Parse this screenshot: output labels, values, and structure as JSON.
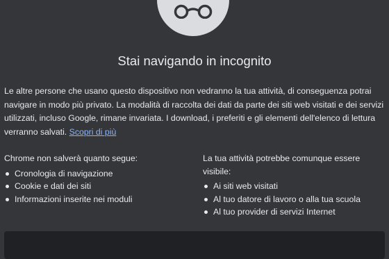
{
  "page": {
    "title": "Stai navigando in incognito",
    "intro_text": "Le altre persone che usano questo dispositivo non vedranno la tua attività, di conseguenza potrai navigare in modo più privato. La modalità di raccolta dei dati da parte dei siti web visitati e dei servizi utilizzati, incluso Google, rimane invariata. I download, i preferiti e gli elementi dell'elenco di lettura verranno salvati.",
    "learn_more_link": "Scopri di più"
  },
  "not_saved": {
    "heading": "Chrome non salverà quanto segue:",
    "items": [
      "Cronologia di navigazione",
      "Cookie e dati dei siti",
      "Informazioni inserite nei moduli"
    ]
  },
  "still_visible": {
    "heading": "La tua attività potrebbe comunque essere visibile:",
    "items": [
      "Ai siti web visitati",
      "Al tuo datore di lavoro o alla tua scuola",
      "Al tuo provider di servizi Internet"
    ]
  },
  "icons": {
    "incognito": "incognito-glasses-icon"
  },
  "colors": {
    "background": "#35363a",
    "text": "#e8eaed",
    "link": "#8ab4f8",
    "icon_circle": "#dadce0",
    "panel": "#202124"
  }
}
